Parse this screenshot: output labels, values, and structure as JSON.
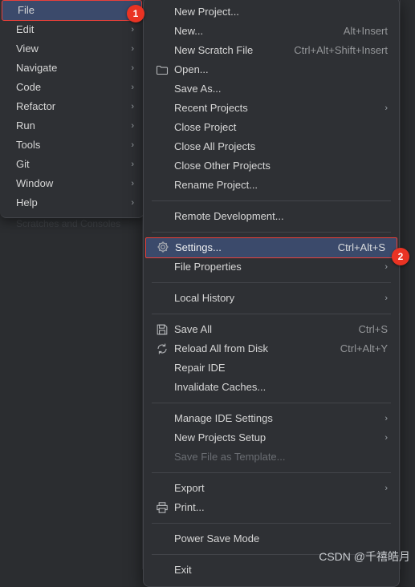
{
  "app": {
    "background_color": "#2b2d30",
    "menu_background_color": "#2e3034",
    "highlight_color": "#3b4a6b",
    "marker_color": "#ea3323",
    "ghost_text": "Scratches and Consoles"
  },
  "menubar": {
    "items": [
      {
        "label": "File",
        "selected": true,
        "submenu": false
      },
      {
        "label": "Edit",
        "selected": false,
        "submenu": true
      },
      {
        "label": "View",
        "selected": false,
        "submenu": true
      },
      {
        "label": "Navigate",
        "selected": false,
        "submenu": true
      },
      {
        "label": "Code",
        "selected": false,
        "submenu": true
      },
      {
        "label": "Refactor",
        "selected": false,
        "submenu": true
      },
      {
        "label": "Run",
        "selected": false,
        "submenu": true
      },
      {
        "label": "Tools",
        "selected": false,
        "submenu": true
      },
      {
        "label": "Git",
        "selected": false,
        "submenu": true
      },
      {
        "label": "Window",
        "selected": false,
        "submenu": true
      },
      {
        "label": "Help",
        "selected": false,
        "submenu": true
      }
    ]
  },
  "file_menu": {
    "groups": [
      {
        "items": [
          {
            "label": "New Project...",
            "shortcut": "",
            "icon": "",
            "submenu": false,
            "disabled": false,
            "selected": false
          },
          {
            "label": "New...",
            "shortcut": "Alt+Insert",
            "icon": "",
            "submenu": false,
            "disabled": false,
            "selected": false
          },
          {
            "label": "New Scratch File",
            "shortcut": "Ctrl+Alt+Shift+Insert",
            "icon": "",
            "submenu": false,
            "disabled": false,
            "selected": false
          },
          {
            "label": "Open...",
            "shortcut": "",
            "icon": "folder-icon",
            "submenu": false,
            "disabled": false,
            "selected": false
          },
          {
            "label": "Save As...",
            "shortcut": "",
            "icon": "",
            "submenu": false,
            "disabled": false,
            "selected": false
          },
          {
            "label": "Recent Projects",
            "shortcut": "",
            "icon": "",
            "submenu": true,
            "disabled": false,
            "selected": false
          },
          {
            "label": "Close Project",
            "shortcut": "",
            "icon": "",
            "submenu": false,
            "disabled": false,
            "selected": false
          },
          {
            "label": "Close All Projects",
            "shortcut": "",
            "icon": "",
            "submenu": false,
            "disabled": false,
            "selected": false
          },
          {
            "label": "Close Other Projects",
            "shortcut": "",
            "icon": "",
            "submenu": false,
            "disabled": false,
            "selected": false
          },
          {
            "label": "Rename Project...",
            "shortcut": "",
            "icon": "",
            "submenu": false,
            "disabled": false,
            "selected": false
          }
        ]
      },
      {
        "items": [
          {
            "label": "Remote Development...",
            "shortcut": "",
            "icon": "",
            "submenu": false,
            "disabled": false,
            "selected": false
          }
        ]
      },
      {
        "items": [
          {
            "label": "Settings...",
            "shortcut": "Ctrl+Alt+S",
            "icon": "gear-icon",
            "submenu": false,
            "disabled": false,
            "selected": true
          },
          {
            "label": "File Properties",
            "shortcut": "",
            "icon": "",
            "submenu": true,
            "disabled": false,
            "selected": false
          }
        ]
      },
      {
        "items": [
          {
            "label": "Local History",
            "shortcut": "",
            "icon": "",
            "submenu": true,
            "disabled": false,
            "selected": false
          }
        ]
      },
      {
        "items": [
          {
            "label": "Save All",
            "shortcut": "Ctrl+S",
            "icon": "save-icon",
            "submenu": false,
            "disabled": false,
            "selected": false
          },
          {
            "label": "Reload All from Disk",
            "shortcut": "Ctrl+Alt+Y",
            "icon": "reload-icon",
            "submenu": false,
            "disabled": false,
            "selected": false
          },
          {
            "label": "Repair IDE",
            "shortcut": "",
            "icon": "",
            "submenu": false,
            "disabled": false,
            "selected": false
          },
          {
            "label": "Invalidate Caches...",
            "shortcut": "",
            "icon": "",
            "submenu": false,
            "disabled": false,
            "selected": false
          }
        ]
      },
      {
        "items": [
          {
            "label": "Manage IDE Settings",
            "shortcut": "",
            "icon": "",
            "submenu": true,
            "disabled": false,
            "selected": false
          },
          {
            "label": "New Projects Setup",
            "shortcut": "",
            "icon": "",
            "submenu": true,
            "disabled": false,
            "selected": false
          },
          {
            "label": "Save File as Template...",
            "shortcut": "",
            "icon": "",
            "submenu": false,
            "disabled": true,
            "selected": false
          }
        ]
      },
      {
        "items": [
          {
            "label": "Export",
            "shortcut": "",
            "icon": "",
            "submenu": true,
            "disabled": false,
            "selected": false
          },
          {
            "label": "Print...",
            "shortcut": "",
            "icon": "print-icon",
            "submenu": false,
            "disabled": false,
            "selected": false
          }
        ]
      },
      {
        "items": [
          {
            "label": "Power Save Mode",
            "shortcut": "",
            "icon": "",
            "submenu": false,
            "disabled": false,
            "selected": false
          }
        ]
      },
      {
        "items": [
          {
            "label": "Exit",
            "shortcut": "",
            "icon": "",
            "submenu": false,
            "disabled": false,
            "selected": false
          }
        ]
      }
    ]
  },
  "markers": [
    {
      "label": "1"
    },
    {
      "label": "2"
    }
  ],
  "watermark": {
    "text": "CSDN @千禧皓月"
  }
}
